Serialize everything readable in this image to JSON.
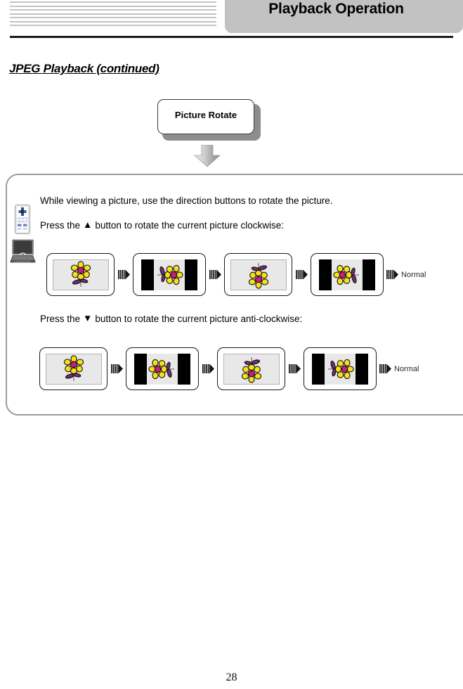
{
  "header": {
    "banner_title": "Playback Operation",
    "stripe_count": 7,
    "banner_color": "#c2c2c2",
    "rule_color": "#1c1c1c"
  },
  "section": {
    "title": "JPEG Playback (continued)"
  },
  "callout": {
    "label": "Picture Rotate",
    "arrow_icon": "down-arrow-icon"
  },
  "icons": {
    "remote": "remote-control-icon",
    "player": "portable-dvd-player-icon"
  },
  "instructions": {
    "intro": "While viewing a picture, use the direction buttons to rotate the picture.",
    "clockwise_prefix": "Press the",
    "clockwise_glyph": "▲",
    "clockwise_suffix": "button to rotate the current picture clockwise:",
    "anticlockwise_prefix": "Press the",
    "anticlockwise_glyph": "▼",
    "anticlockwise_suffix": "button to rotate the current picture anti-clockwise:"
  },
  "rotation_rows": [
    {
      "direction": "clockwise",
      "separator_icon": "fast-forward-icon",
      "end_label": "Normal",
      "frames": [
        {
          "rotation": 0,
          "letterbox": false
        },
        {
          "rotation": 90,
          "letterbox": true
        },
        {
          "rotation": 180,
          "letterbox": false
        },
        {
          "rotation": 270,
          "letterbox": true
        }
      ]
    },
    {
      "direction": "anti-clockwise",
      "separator_icon": "fast-forward-icon",
      "end_label": "Normal",
      "frames": [
        {
          "rotation": 0,
          "letterbox": false
        },
        {
          "rotation": -90,
          "letterbox": true
        },
        {
          "rotation": -180,
          "letterbox": false
        },
        {
          "rotation": -270,
          "letterbox": true
        }
      ]
    }
  ],
  "artwork": {
    "flower_petal_color": "#f7e019",
    "flower_center_color": "#cc1b7a",
    "flower_leaf_color": "#6b3070",
    "flower_stem_color": "#6f6f6f",
    "screen_background": "#e8e8e8",
    "letterbox_color": "#000000"
  },
  "footer": {
    "page_number": "28"
  }
}
